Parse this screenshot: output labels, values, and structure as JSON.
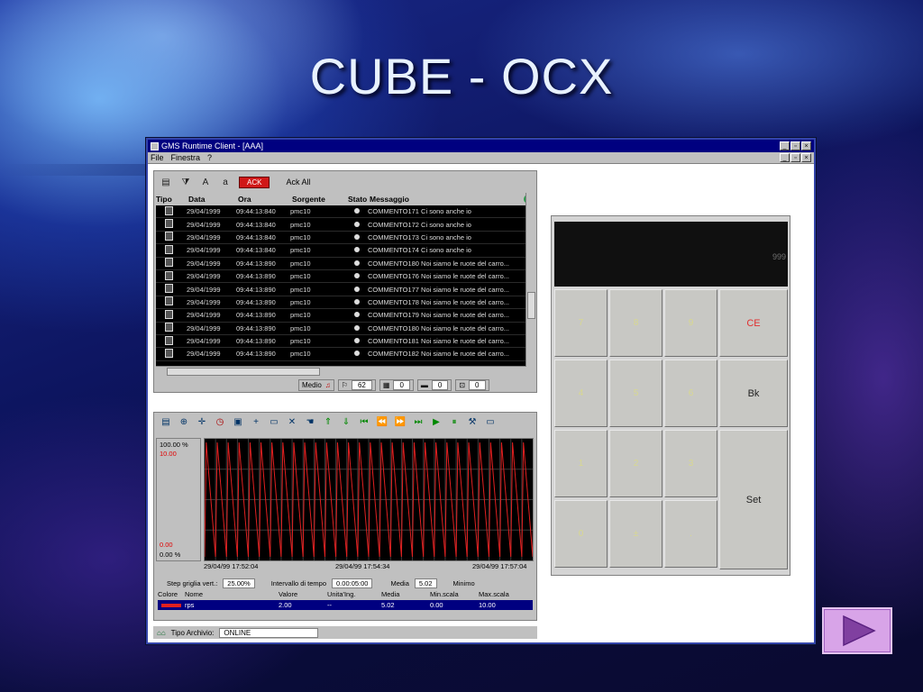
{
  "slide": {
    "title": "CUBE - OCX"
  },
  "window": {
    "title": "GMS Runtime Client - [AAA]",
    "controls": [
      "_",
      "▫",
      "×"
    ],
    "menu": [
      "File",
      "Finestra",
      "?"
    ],
    "mdi_controls": [
      "_",
      "▫",
      "×"
    ]
  },
  "alarm_panel": {
    "ack_label": "ACK",
    "ack_all_label": "Ack All",
    "columns": [
      "Tipo",
      "Data",
      "Ora",
      "Sorgente",
      "Stato",
      "Messaggio"
    ],
    "rows": [
      {
        "data": "29/04/1999",
        "ora": "09:44:13:840",
        "sorgente": "pmc10",
        "messaggio": "COMMENTO171 Ci sono anche io"
      },
      {
        "data": "29/04/1999",
        "ora": "09:44:13:840",
        "sorgente": "pmc10",
        "messaggio": "COMMENTO172 Ci sono anche io"
      },
      {
        "data": "29/04/1999",
        "ora": "09:44:13:840",
        "sorgente": "pmc10",
        "messaggio": "COMMENTO173 Ci sono anche io"
      },
      {
        "data": "29/04/1999",
        "ora": "09:44:13:840",
        "sorgente": "pmc10",
        "messaggio": "COMMENTO174 Ci sono anche io"
      },
      {
        "data": "29/04/1999",
        "ora": "09:44:13:890",
        "sorgente": "pmc10",
        "messaggio": "COMMENTO180 Noi siamo le ruote del carro..."
      },
      {
        "data": "29/04/1999",
        "ora": "09:44:13:890",
        "sorgente": "pmc10",
        "messaggio": "COMMENTO176 Noi siamo le ruote del carro..."
      },
      {
        "data": "29/04/1999",
        "ora": "09:44:13:890",
        "sorgente": "pmc10",
        "messaggio": "COMMENTO177 Noi siamo le ruote del carro..."
      },
      {
        "data": "29/04/1999",
        "ora": "09:44:13:890",
        "sorgente": "pmc10",
        "messaggio": "COMMENTO178 Noi siamo le ruote del carro..."
      },
      {
        "data": "29/04/1999",
        "ora": "09:44:13:890",
        "sorgente": "pmc10",
        "messaggio": "COMMENTO179 Noi siamo le ruote del carro..."
      },
      {
        "data": "29/04/1999",
        "ora": "09:44:13:890",
        "sorgente": "pmc10",
        "messaggio": "COMMENTO180 Noi siamo le ruote del carro..."
      },
      {
        "data": "29/04/1999",
        "ora": "09:44:13:890",
        "sorgente": "pmc10",
        "messaggio": "COMMENTO181 Noi siamo le ruote del carro..."
      },
      {
        "data": "29/04/1999",
        "ora": "09:44:13:890",
        "sorgente": "pmc10",
        "messaggio": "COMMENTO182 Noi siamo le ruote del carro..."
      }
    ],
    "status": {
      "mode_label": "Medio",
      "count_1": "62",
      "count_2": "0",
      "count_3": "0",
      "count_4": "0"
    }
  },
  "trend_panel": {
    "scale_top": "100.00 %",
    "scale_top_red": "10.00",
    "scale_bottom_red": "0.00",
    "scale_bottom": "0.00 %",
    "time_labels": [
      "29/04/99 17:52:04",
      "29/04/99 17:54:34",
      "29/04/99 17:57:04"
    ],
    "step_label": "Step griglia vert.:",
    "step_value": "25.00%",
    "interval_label": "Intervallo di tempo",
    "interval_value": "0.00:05:00",
    "media_label": "Media",
    "media_value": "5.02",
    "minimo_label": "Minimo",
    "legend_columns": [
      "Colore",
      "Nome",
      "Valore",
      "Unita'Ing.",
      "Media",
      "Min.scala",
      "Max.scala"
    ],
    "legend_row": {
      "nome": "rps",
      "valore": "2.00",
      "unita": "--",
      "media": "5.02",
      "min": "0.00",
      "max": "10.00"
    },
    "series_color": "#e02020"
  },
  "status_bar": {
    "archive_label": "Tipo Archivio:",
    "archive_value": "ONLINE"
  },
  "keypad": {
    "display_value": "999",
    "keys": [
      "7",
      "8",
      "9",
      "4",
      "5",
      "6",
      "1",
      "2",
      "3",
      "0",
      "±",
      "."
    ],
    "ce_label": "CE",
    "bk_label": "Bk",
    "set_label": "Set"
  },
  "colors": {
    "title_bar": "#000080",
    "ack": "#d01818",
    "nav_button": "#d8a4e8",
    "nav_arrow": "#8040a0"
  }
}
